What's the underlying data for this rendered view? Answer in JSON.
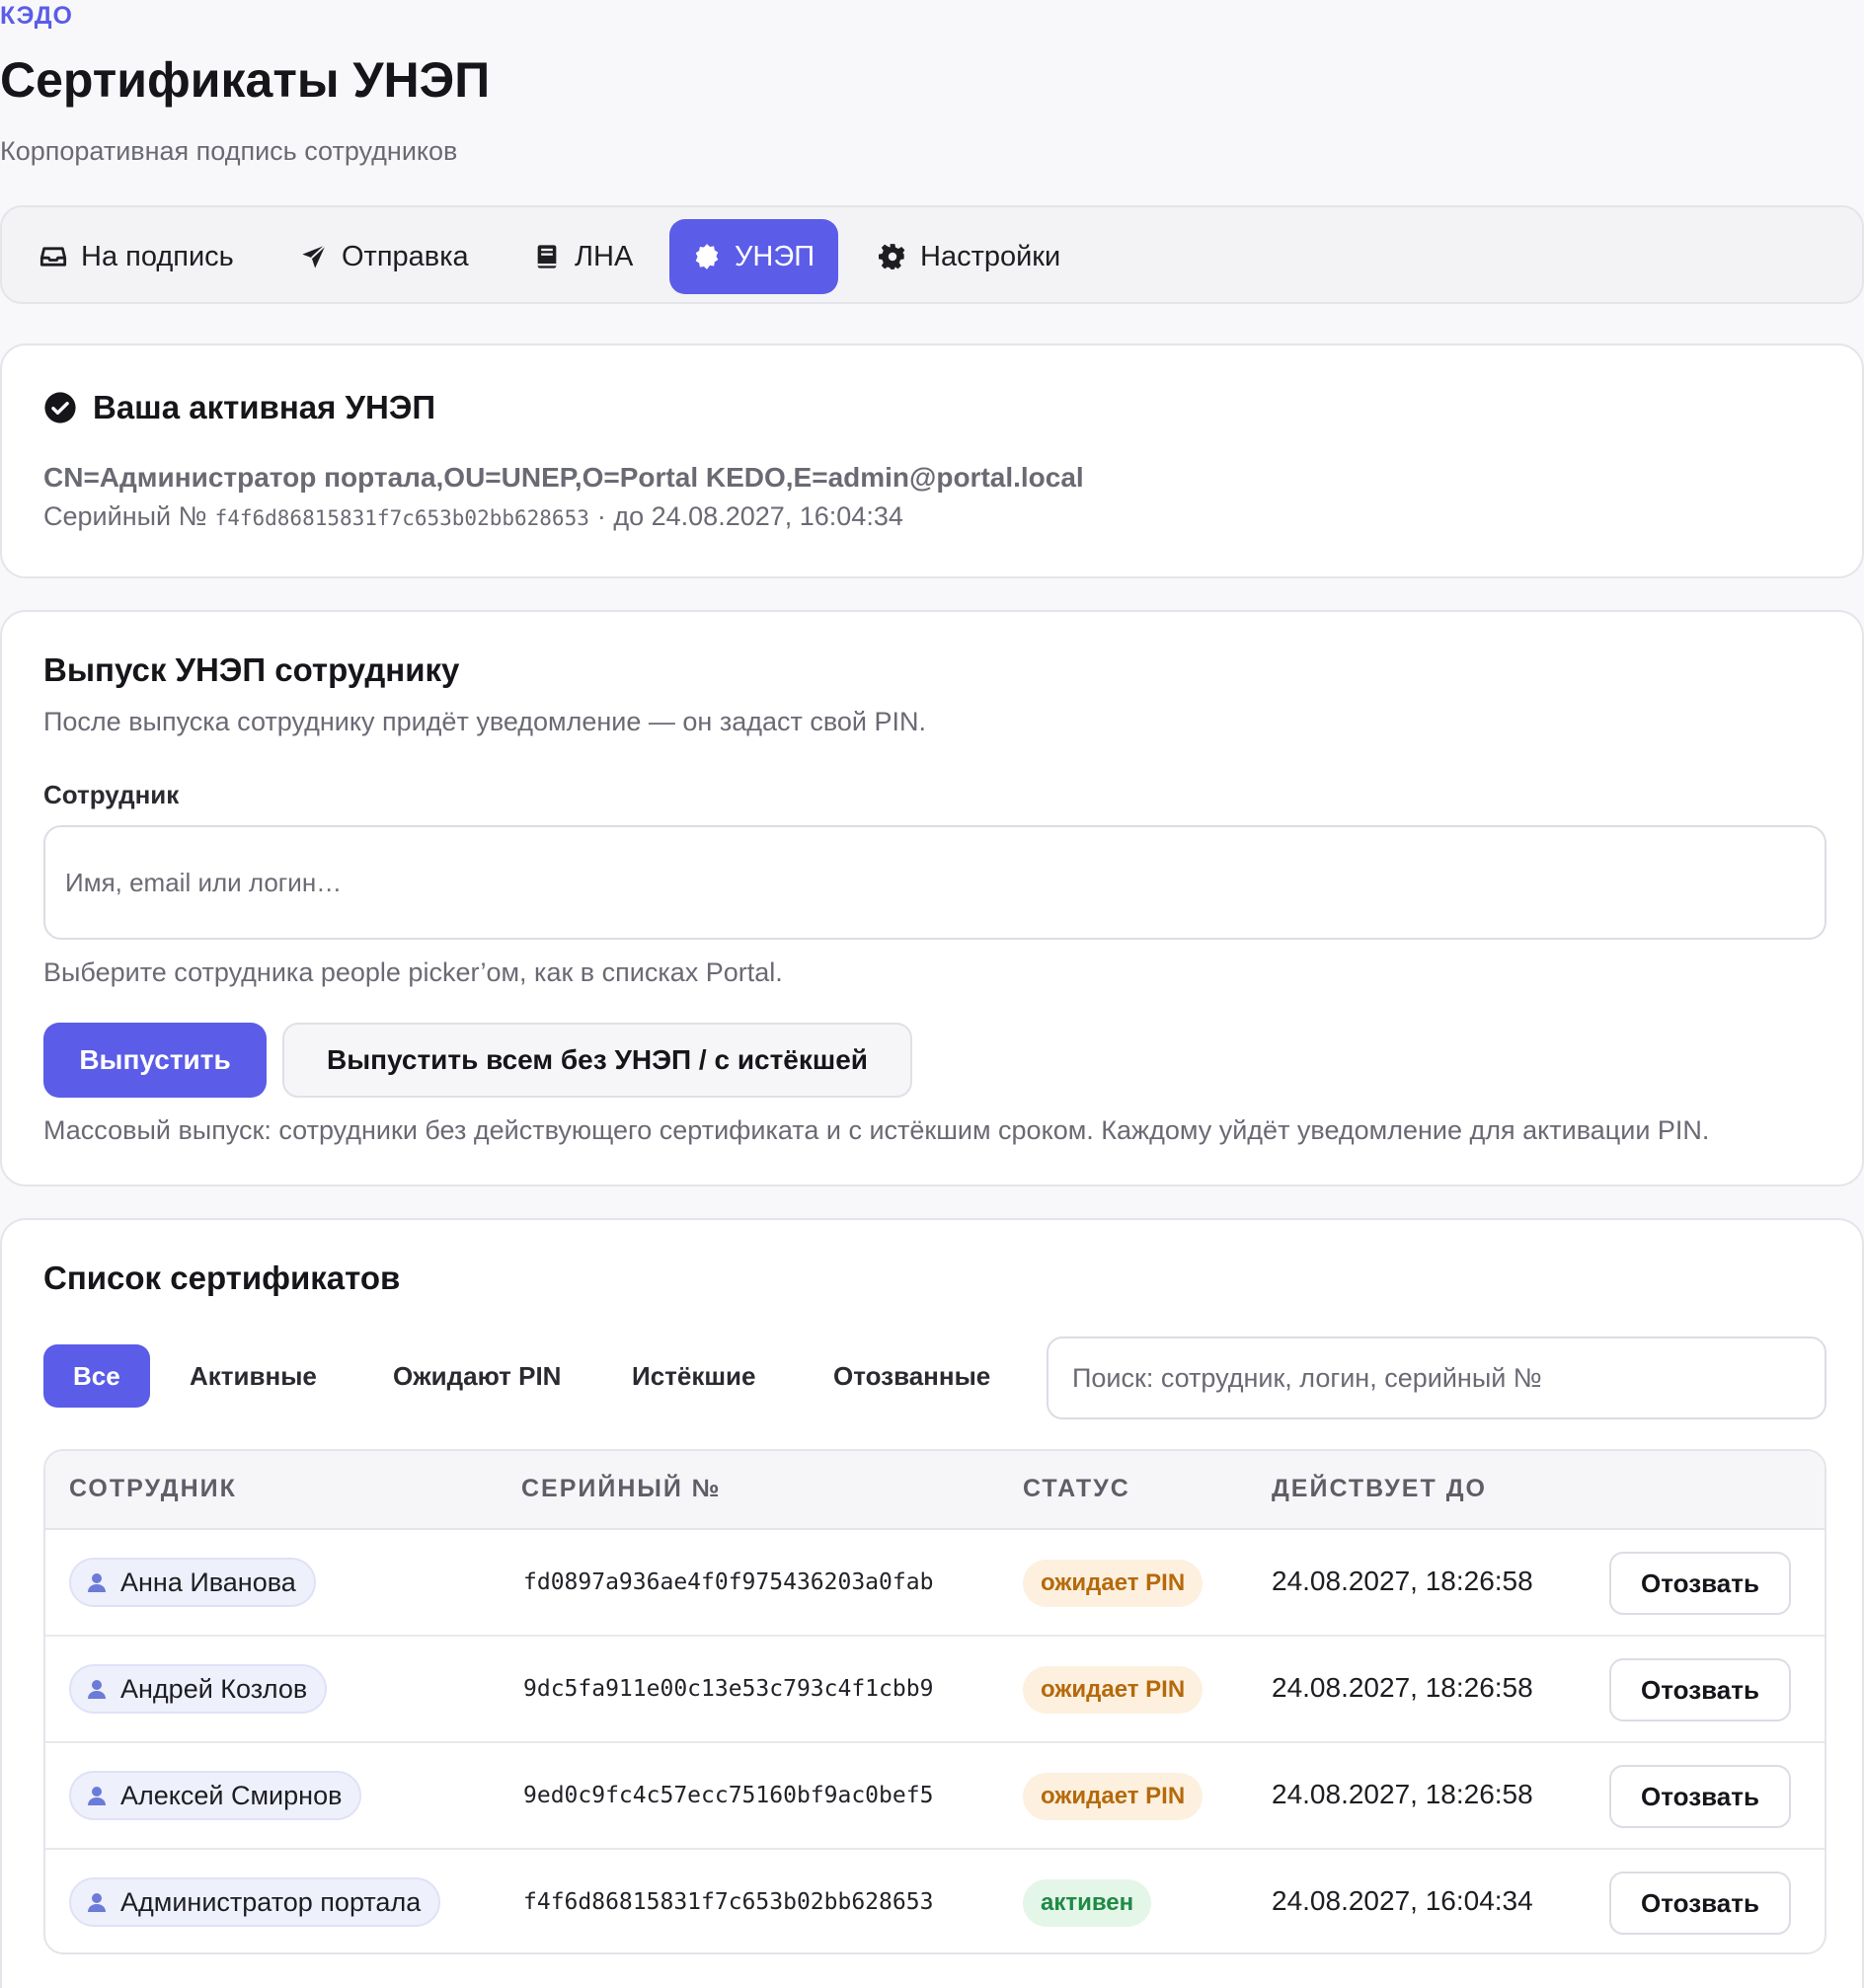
{
  "eyebrow": "КЭДО",
  "title": "Сертификаты УНЭП",
  "subtitle": "Корпоративная подпись сотрудников",
  "tabs": [
    {
      "label": "На подпись",
      "icon": "inbox-icon"
    },
    {
      "label": "Отправка",
      "icon": "send-icon"
    },
    {
      "label": "ЛНА",
      "icon": "book-icon"
    },
    {
      "label": "УНЭП",
      "icon": "badge-icon",
      "active": true
    },
    {
      "label": "Настройки",
      "icon": "gear-icon"
    }
  ],
  "active_cert": {
    "title": "Ваша активная УНЭП",
    "cn": "CN=Администратор портала,OU=UNEP,O=Portal KEDO,E=admin@portal.local",
    "serial_label": "Серийный №",
    "serial": "f4f6d86815831f7c653b02bb628653",
    "valid_until": "· до 24.08.2027, 16:04:34"
  },
  "issue": {
    "title": "Выпуск УНЭП сотруднику",
    "description": "После выпуска сотруднику придёт уведомление — он задаст свой PIN.",
    "employee_label": "Сотрудник",
    "employee_placeholder": "Имя, email или логин…",
    "hint": "Выберите сотрудника people picker’ом, как в списках Portal.",
    "issue_button": "Выпустить",
    "issue_all_button": "Выпустить всем без УНЭП / с истёкшей",
    "mass_note": "Массовый выпуск: сотрудники без действующего сертификата и с истёкшим сроком. Каждому уйдёт уведомление для активации PIN."
  },
  "list": {
    "title": "Список сертификатов",
    "filters": [
      "Все",
      "Активные",
      "Ожидают PIN",
      "Истёкшие",
      "Отозванные"
    ],
    "active_filter": "Все",
    "search_placeholder": "Поиск: сотрудник, логин, серийный №",
    "columns": [
      "СОТРУДНИК",
      "СЕРИЙНЫЙ №",
      "СТАТУС",
      "ДЕЙСТВУЕТ ДО"
    ],
    "rows": [
      {
        "employee": "Анна Иванова",
        "serial": "fd0897a936ae4f0f975436203a0fab",
        "status": "ожидает PIN",
        "status_kind": "pending",
        "valid_until": "24.08.2027, 18:26:58",
        "action": "Отозвать"
      },
      {
        "employee": "Андрей Козлов",
        "serial": "9dc5fa911e00c13e53c793c4f1cbb9",
        "status": "ожидает PIN",
        "status_kind": "pending",
        "valid_until": "24.08.2027, 18:26:58",
        "action": "Отозвать"
      },
      {
        "employee": "Алексей Смирнов",
        "serial": "9ed0c9fc4c57ecc75160bf9ac0bef5",
        "status": "ожидает PIN",
        "status_kind": "pending",
        "valid_until": "24.08.2027, 18:26:58",
        "action": "Отозвать"
      },
      {
        "employee": "Администратор портала",
        "serial": "f4f6d86815831f7c653b02bb628653",
        "status": "активен",
        "status_kind": "active",
        "valid_until": "24.08.2027, 16:04:34",
        "action": "Отозвать"
      }
    ]
  },
  "colors": {
    "accent": "#5b5ce8",
    "pending_text": "#b56a0b",
    "pending_bg": "#fdf0df",
    "active_text": "#1f8a45",
    "active_bg": "#e3f6e8"
  }
}
